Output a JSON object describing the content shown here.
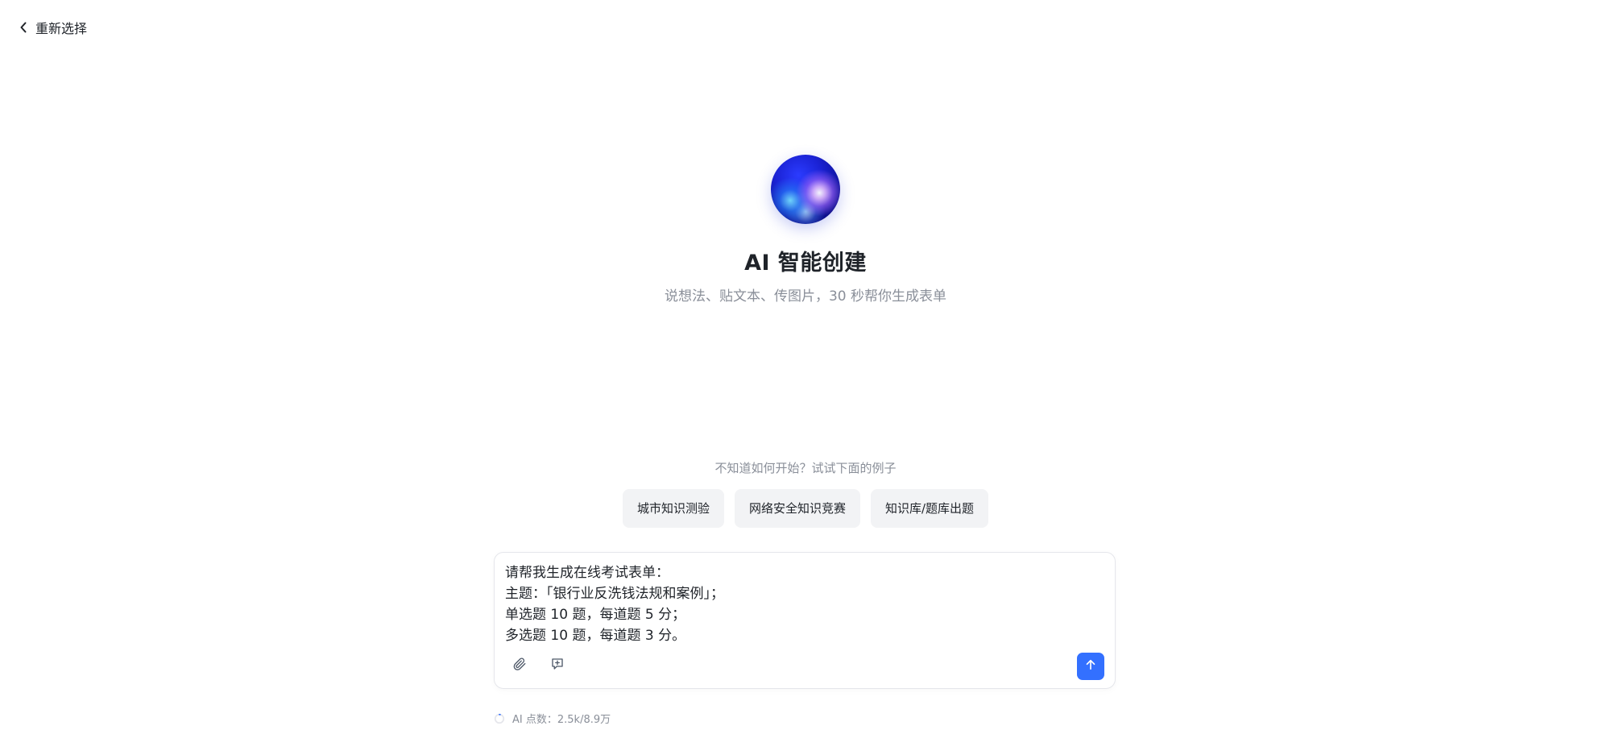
{
  "nav": {
    "back_label": "重新选择"
  },
  "hero": {
    "title": "AI 智能创建",
    "subtitle": "说想法、贴文本、传图片，30 秒帮你生成表单"
  },
  "examples": {
    "hint": "不知道如何开始？试试下面的例子",
    "items": [
      {
        "label": "城市知识测验"
      },
      {
        "label": "网络安全知识竞赛"
      },
      {
        "label": "知识库/题库出题"
      }
    ]
  },
  "composer": {
    "text": "请帮我生成在线考试表单：\n主题：「银行业反洗钱法规和案例」；\n单选题 10 题，每道题 5 分；\n多选题 10 题，每道题 3 分。",
    "attach_icon": "paperclip-icon",
    "add_prompt_icon": "add-prompt-icon",
    "send_icon": "arrow-up-icon"
  },
  "ai_points": {
    "label": "AI 点数：",
    "value": "2.5k/8.9万",
    "used": 2500,
    "total": 89000
  },
  "colors": {
    "accent": "#3370ff",
    "text_primary": "#1f2329",
    "text_secondary": "#8a8f99",
    "chip_bg": "#f2f3f5"
  }
}
